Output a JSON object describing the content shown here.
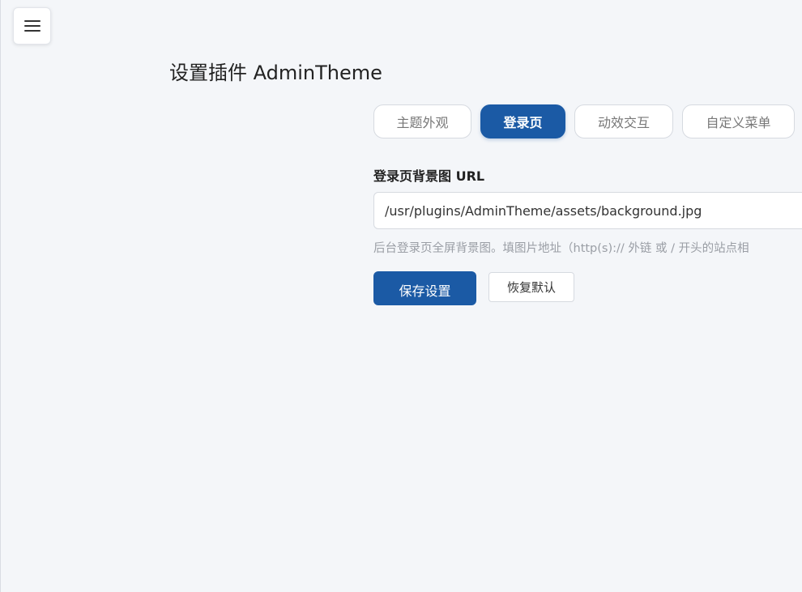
{
  "header": {
    "menu_icon": "hamburger-menu-icon",
    "title": "设置插件 AdminTheme"
  },
  "tabs": [
    {
      "label": "主题外观",
      "active": false
    },
    {
      "label": "登录页",
      "active": true
    },
    {
      "label": "动效交互",
      "active": false
    },
    {
      "label": "自定义菜单",
      "active": false
    }
  ],
  "form": {
    "background_field": {
      "label": "登录页背景图 URL",
      "value": "/usr/plugins/AdminTheme/assets/background.jpg",
      "hint": "后台登录页全屏背景图。填图片地址（http(s):// 外链 或 / 开头的站点相"
    },
    "save_label": "保存设置",
    "reset_label": "恢复默认"
  },
  "colors": {
    "accent": "#1b5aa5",
    "page_background": "#f4f6f9"
  }
}
